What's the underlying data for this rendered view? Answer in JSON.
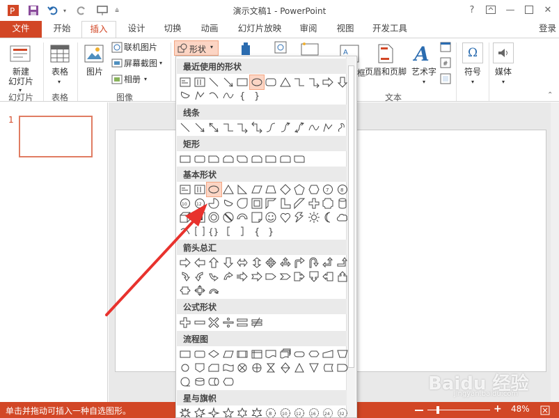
{
  "window": {
    "title": "演示文稿1 - PowerPoint",
    "login_label": "登录"
  },
  "tabs": [
    {
      "label": "文件"
    },
    {
      "label": "开始"
    },
    {
      "label": "插入"
    },
    {
      "label": "设计"
    },
    {
      "label": "切换"
    },
    {
      "label": "动画"
    },
    {
      "label": "幻灯片放映"
    },
    {
      "label": "审阅"
    },
    {
      "label": "视图"
    },
    {
      "label": "开发工具"
    }
  ],
  "ribbon": {
    "new_slide": "新建\n幻灯片",
    "table": "表格",
    "image": "图片",
    "online_image": "联机图片",
    "screenshot": "屏幕截图",
    "album": "相册",
    "shapes": "形状",
    "header_footer": "页眉和页脚",
    "wordart": "艺术字",
    "symbol": "符号",
    "media": "媒体",
    "text_cut": "框",
    "groups": {
      "slides": "幻灯片",
      "tables": "表格",
      "images": "图像",
      "text": "文本"
    }
  },
  "sidebar": {
    "slide_number": "1"
  },
  "shapes_menu": {
    "sections": [
      {
        "title": "最近使用的形状"
      },
      {
        "title": "线条"
      },
      {
        "title": "矩形"
      },
      {
        "title": "基本形状"
      },
      {
        "title": "箭头总汇"
      },
      {
        "title": "公式形状"
      },
      {
        "title": "流程图"
      },
      {
        "title": "星与旗帜"
      }
    ]
  },
  "status": {
    "text": "单击并拖动可插入一种自选图形。",
    "zoom": "48%"
  },
  "colors": {
    "accent": "#d24726",
    "selection": "#fcd5c4"
  },
  "watermark": {
    "brand": "Baidu 经验",
    "url": "jingyan.baidu.com"
  }
}
